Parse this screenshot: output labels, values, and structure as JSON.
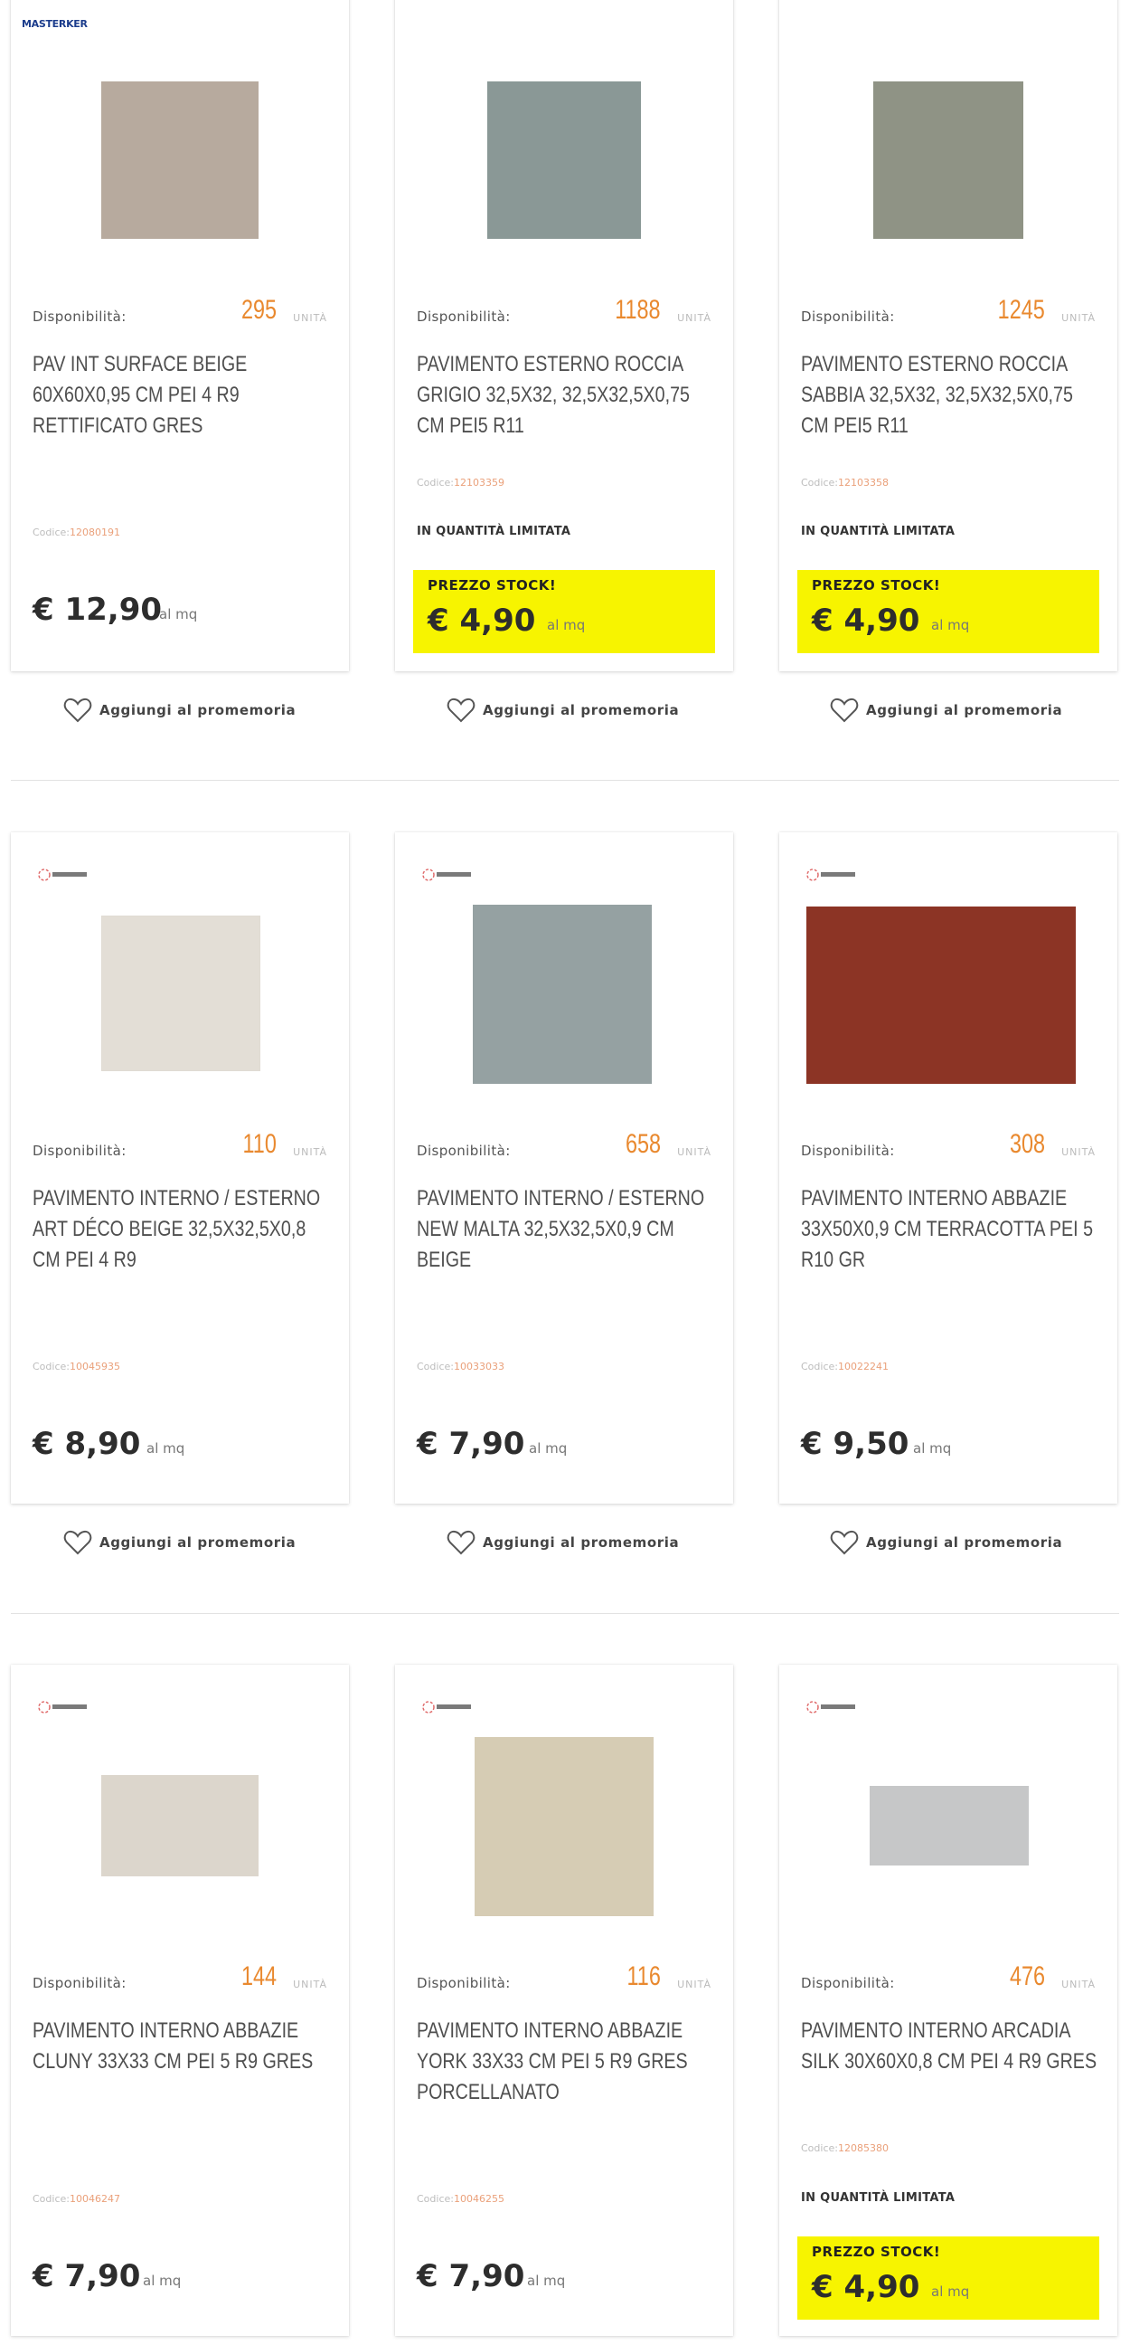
{
  "labels": {
    "availability": "Disponibilità:",
    "unit_word": "UNITÀ",
    "code_label": "Codice:",
    "limited_qty": "IN QUANTITÀ LIMITATA",
    "stock_price": "PREZZO STOCK!",
    "remind": "Aggiungi al promemoria",
    "per_unit": "al mq"
  },
  "products": [
    {
      "brand": "MASTERKER",
      "availability": "295",
      "title": "PAV INT SURFACE BEIGE 60X60X0,95 CM PEI 4 R9 RETTIFICATO GRES",
      "code": "12080191",
      "price": "€ 12,90",
      "stock": false,
      "tile_color": "#b7aa9e",
      "icon": "heart-icon"
    },
    {
      "brand": "",
      "availability": "1188",
      "title": "PAVIMENTO ESTERNO ROCCIA GRIGIO 32,5X32, 32,5X32,5X0,75 CM PEI5 R11",
      "code": "12103359",
      "price": "€ 4,90",
      "stock": true,
      "tile_color": "#8a9896",
      "icon": "heart-icon"
    },
    {
      "brand": "",
      "availability": "1245",
      "title": "PAVIMENTO ESTERNO ROCCIA SABBIA 32,5X32, 32,5X32,5X0,75 CM PEI5 R11",
      "code": "12103358",
      "price": "€ 4,90",
      "stock": true,
      "tile_color": "#8f9385",
      "icon": "heart-icon"
    },
    {
      "brand": "logo",
      "availability": "110",
      "title": "PAVIMENTO INTERNO / ESTERNO ART DÉCO BEIGE 32,5X32,5X0,8 CM PEI 4 R9",
      "code": "10045935",
      "price": "€ 8,90",
      "stock": false,
      "tile_color": "#e3ded6",
      "icon": "heart-icon"
    },
    {
      "brand": "logo",
      "availability": "658",
      "title": "PAVIMENTO INTERNO / ESTERNO NEW MALTA 32,5X32,5X0,9 CM BEIGE",
      "code": "10033033",
      "price": "€ 7,90",
      "stock": false,
      "tile_color": "#95a1a2",
      "icon": "heart-icon"
    },
    {
      "brand": "logo",
      "availability": "308",
      "title": "PAVIMENTO INTERNO ABBAZIE 33X50X0,9 CM TERRACOTTA PEI 5 R10 GR",
      "code": "10022241",
      "price": "€ 9,50",
      "stock": false,
      "tile_color": "#8c3425",
      "icon": "heart-icon"
    },
    {
      "brand": "logo",
      "availability": "144",
      "title": "PAVIMENTO INTERNO ABBAZIE CLUNY 33X33 CM PEI 5 R9 GRES",
      "code": "10046247",
      "price": "€ 7,90",
      "stock": false,
      "tile_color": "#dcd6cc",
      "icon": "heart-icon"
    },
    {
      "brand": "logo",
      "availability": "116",
      "title": "PAVIMENTO INTERNO ABBAZIE YORK 33X33 CM PEI 5 R9 GRES PORCELLANATO",
      "code": "10046255",
      "price": "€ 7,90",
      "stock": false,
      "tile_color": "#d6ccb4",
      "icon": "heart-icon"
    },
    {
      "brand": "logo",
      "availability": "476",
      "title": "PAVIMENTO INTERNO ARCADIA SILK 30X60X0,8 CM PEI 4 R9 GRES",
      "code": "12085380",
      "price": "€ 4,90",
      "stock": true,
      "tile_color": "#c6c7c8",
      "icon": "heart-icon"
    }
  ]
}
